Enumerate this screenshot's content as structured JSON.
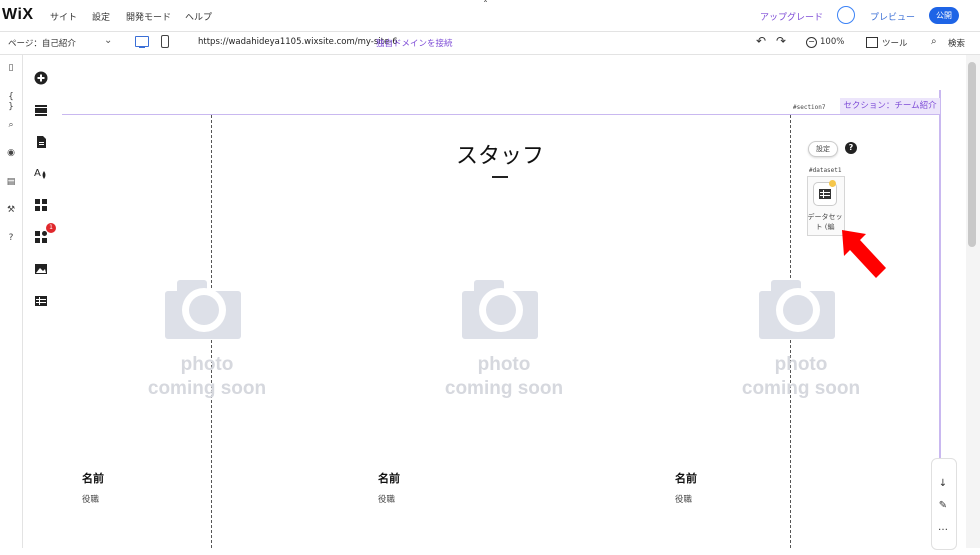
{
  "topbar": {
    "logo": "WiX",
    "menu": [
      "サイト",
      "設定",
      "開発モード",
      "ヘルプ"
    ],
    "upgrade": "アップグレード",
    "preview": "プレビュー",
    "publish": "公開",
    "caret": "ˆ"
  },
  "addressbar": {
    "page": "ページ：自己紹介",
    "url": "https://wadahideya1105.wixsite.com/my-site-6",
    "connect_domain": "独自ドメインを接続",
    "zoom": "100%",
    "tools": "ツール",
    "search": "検索"
  },
  "rail1": [
    "▯",
    "{ }",
    "⌕",
    "◉",
    "▤",
    "⚒",
    "?"
  ],
  "rail2": {
    "items": [
      "add",
      "sections",
      "pages",
      "design",
      "apps",
      "business",
      "media",
      "cms"
    ],
    "business_badge": "1"
  },
  "canvas": {
    "section_id": "#section7",
    "section_label": "セクション：チーム紹介",
    "title": "スタッフ",
    "dataset": {
      "settings": "設定",
      "help": "?",
      "id": "#dataset1",
      "label": "データセット (編"
    },
    "members": [
      {
        "photo_line1": "photo",
        "photo_line2": "coming soon",
        "name": "名前",
        "role": "役職"
      },
      {
        "photo_line1": "photo",
        "photo_line2": "coming soon",
        "name": "名前",
        "role": "役職"
      },
      {
        "photo_line1": "photo",
        "photo_line2": "coming soon",
        "name": "名前",
        "role": "役職"
      }
    ]
  },
  "float_tools": [
    "↓",
    "✎",
    "…"
  ],
  "colors": {
    "accent_purple": "#7d4bd6",
    "publish_blue": "#1e64e6",
    "arrow_red": "#ff0000"
  }
}
